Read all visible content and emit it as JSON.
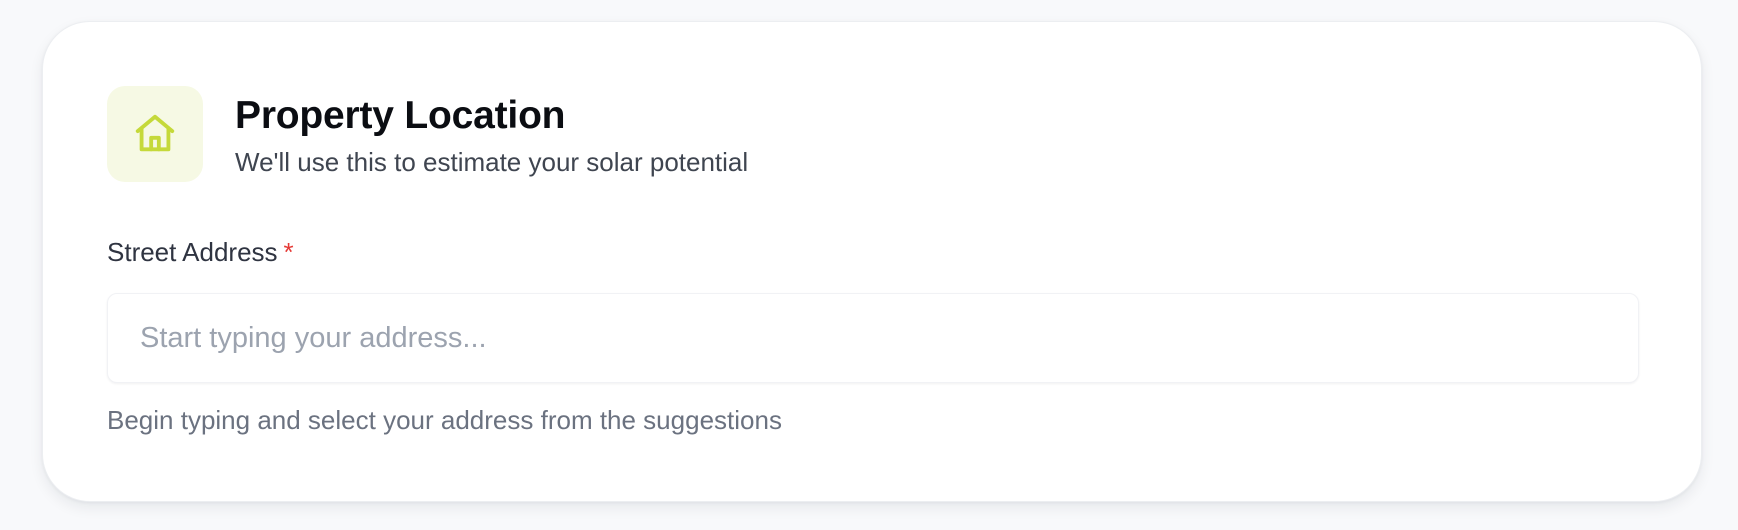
{
  "card": {
    "title": "Property Location",
    "subtitle": "We'll use this to estimate your solar potential",
    "icon": "home-icon"
  },
  "address_field": {
    "label": "Street Address",
    "required_marker": "*",
    "placeholder": "Start typing your address...",
    "value": "",
    "hint": "Begin typing and select your address from the suggestions"
  },
  "colors": {
    "page_background": "#f8f9fb",
    "icon_tile_background": "#f6f9e4",
    "icon_accent": "#c5d93a",
    "required": "#e53935"
  }
}
